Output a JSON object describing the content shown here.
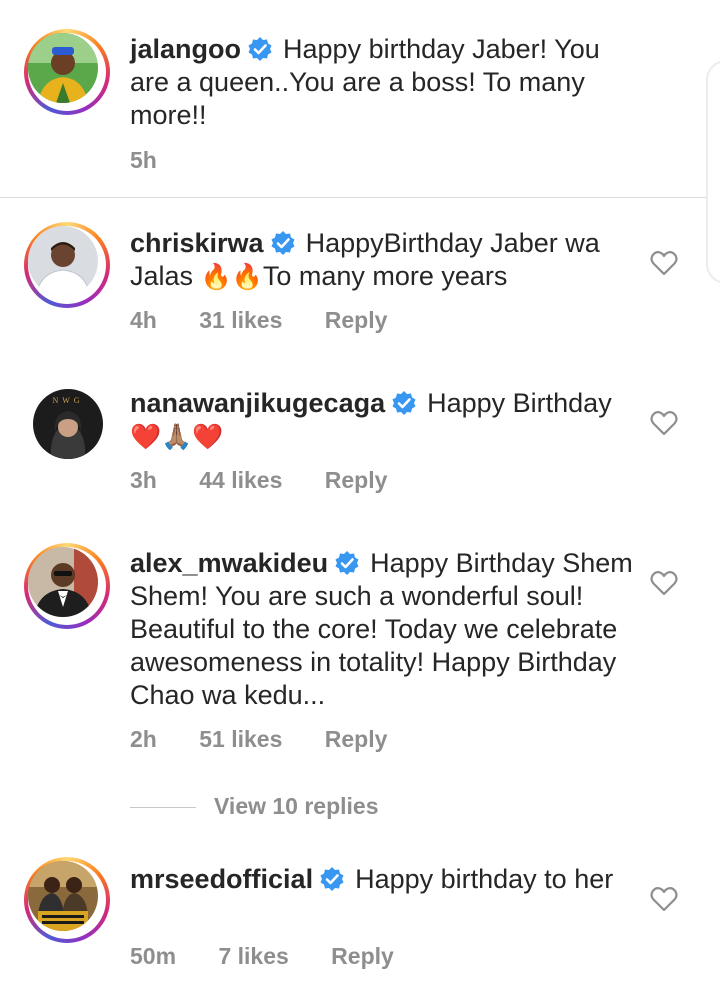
{
  "comments": [
    {
      "username": "jalangoo",
      "verified": true,
      "text": "Happy birthday Jaber!  You are a queen..You are a boss!  To many more!!",
      "time": "5h",
      "likes": "",
      "reply": ""
    },
    {
      "username": "chriskirwa",
      "verified": true,
      "text_before": "HappyBirthday Jaber wa Jalas",
      "emoji": "🔥🔥",
      "text_after": "To many more years",
      "time": "4h",
      "likes": "31 likes",
      "reply": "Reply"
    },
    {
      "username": "nanawanjikugecaga",
      "verified": true,
      "text": "Happy Birthday",
      "emoji": "❤️🙏🏽❤️",
      "time": "3h",
      "likes": "44 likes",
      "reply": "Reply"
    },
    {
      "username": "alex_mwakideu",
      "verified": true,
      "text": "Happy Birthday Shem Shem! You are such a wonderful soul! Beautiful to the core! Today we celebrate awesomeness in totality! Happy Birthday Chao wa kedu...",
      "time": "2h",
      "likes": "51 likes",
      "reply": "Reply",
      "view_replies": "View 10 replies"
    },
    {
      "username": "mrseedofficial",
      "verified": true,
      "text": "Happy birthday to her",
      "time": "50m",
      "likes": "7 likes",
      "reply": "Reply"
    }
  ],
  "avatar_logo_text": "NWG",
  "colors": {
    "verified_blue": "#3897f0",
    "muted_gray": "#8e8e8e",
    "text_dark": "#262626"
  },
  "icons": {
    "verified": "verified-badge-icon",
    "heart": "heart-outline-icon"
  }
}
